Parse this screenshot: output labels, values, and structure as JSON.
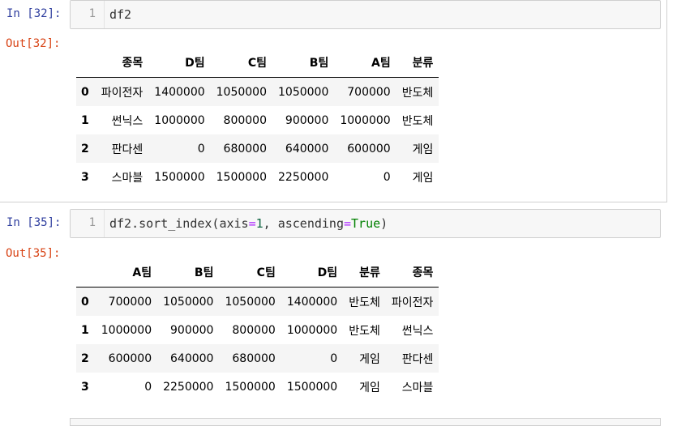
{
  "cells": [
    {
      "in_prompt": "In [32]:",
      "line_number": "1",
      "code": "df2",
      "out_prompt": "Out[32]:",
      "table": {
        "columns": [
          "종목",
          "D팀",
          "C팀",
          "B팀",
          "A팀",
          "분류"
        ],
        "rows": [
          {
            "index": "0",
            "values": [
              "파이전자",
              "1400000",
              "1050000",
              "1050000",
              "700000",
              "반도체"
            ]
          },
          {
            "index": "1",
            "values": [
              "썬닉스",
              "1000000",
              "800000",
              "900000",
              "1000000",
              "반도체"
            ]
          },
          {
            "index": "2",
            "values": [
              "판다센",
              "0",
              "680000",
              "640000",
              "600000",
              "게임"
            ]
          },
          {
            "index": "3",
            "values": [
              "스마블",
              "1500000",
              "1500000",
              "2250000",
              "0",
              "게임"
            ]
          }
        ]
      }
    },
    {
      "in_prompt": "In [35]:",
      "line_number": "1",
      "code_parts": {
        "prefix": "df2.sort_index(axis",
        "eq1": "=",
        "num": "1",
        "mid": ", ascending",
        "eq2": "=",
        "kw": "True",
        "suffix": ")"
      },
      "out_prompt": "Out[35]:",
      "table": {
        "columns": [
          "A팀",
          "B팀",
          "C팀",
          "D팀",
          "분류",
          "종목"
        ],
        "rows": [
          {
            "index": "0",
            "values": [
              "700000",
              "1050000",
              "1050000",
              "1400000",
              "반도체",
              "파이전자"
            ]
          },
          {
            "index": "1",
            "values": [
              "1000000",
              "900000",
              "800000",
              "1000000",
              "반도체",
              "썬닉스"
            ]
          },
          {
            "index": "2",
            "values": [
              "600000",
              "640000",
              "680000",
              "0",
              "게임",
              "판다센"
            ]
          },
          {
            "index": "3",
            "values": [
              "0",
              "2250000",
              "1500000",
              "1500000",
              "게임",
              "스마블"
            ]
          }
        ]
      }
    }
  ]
}
